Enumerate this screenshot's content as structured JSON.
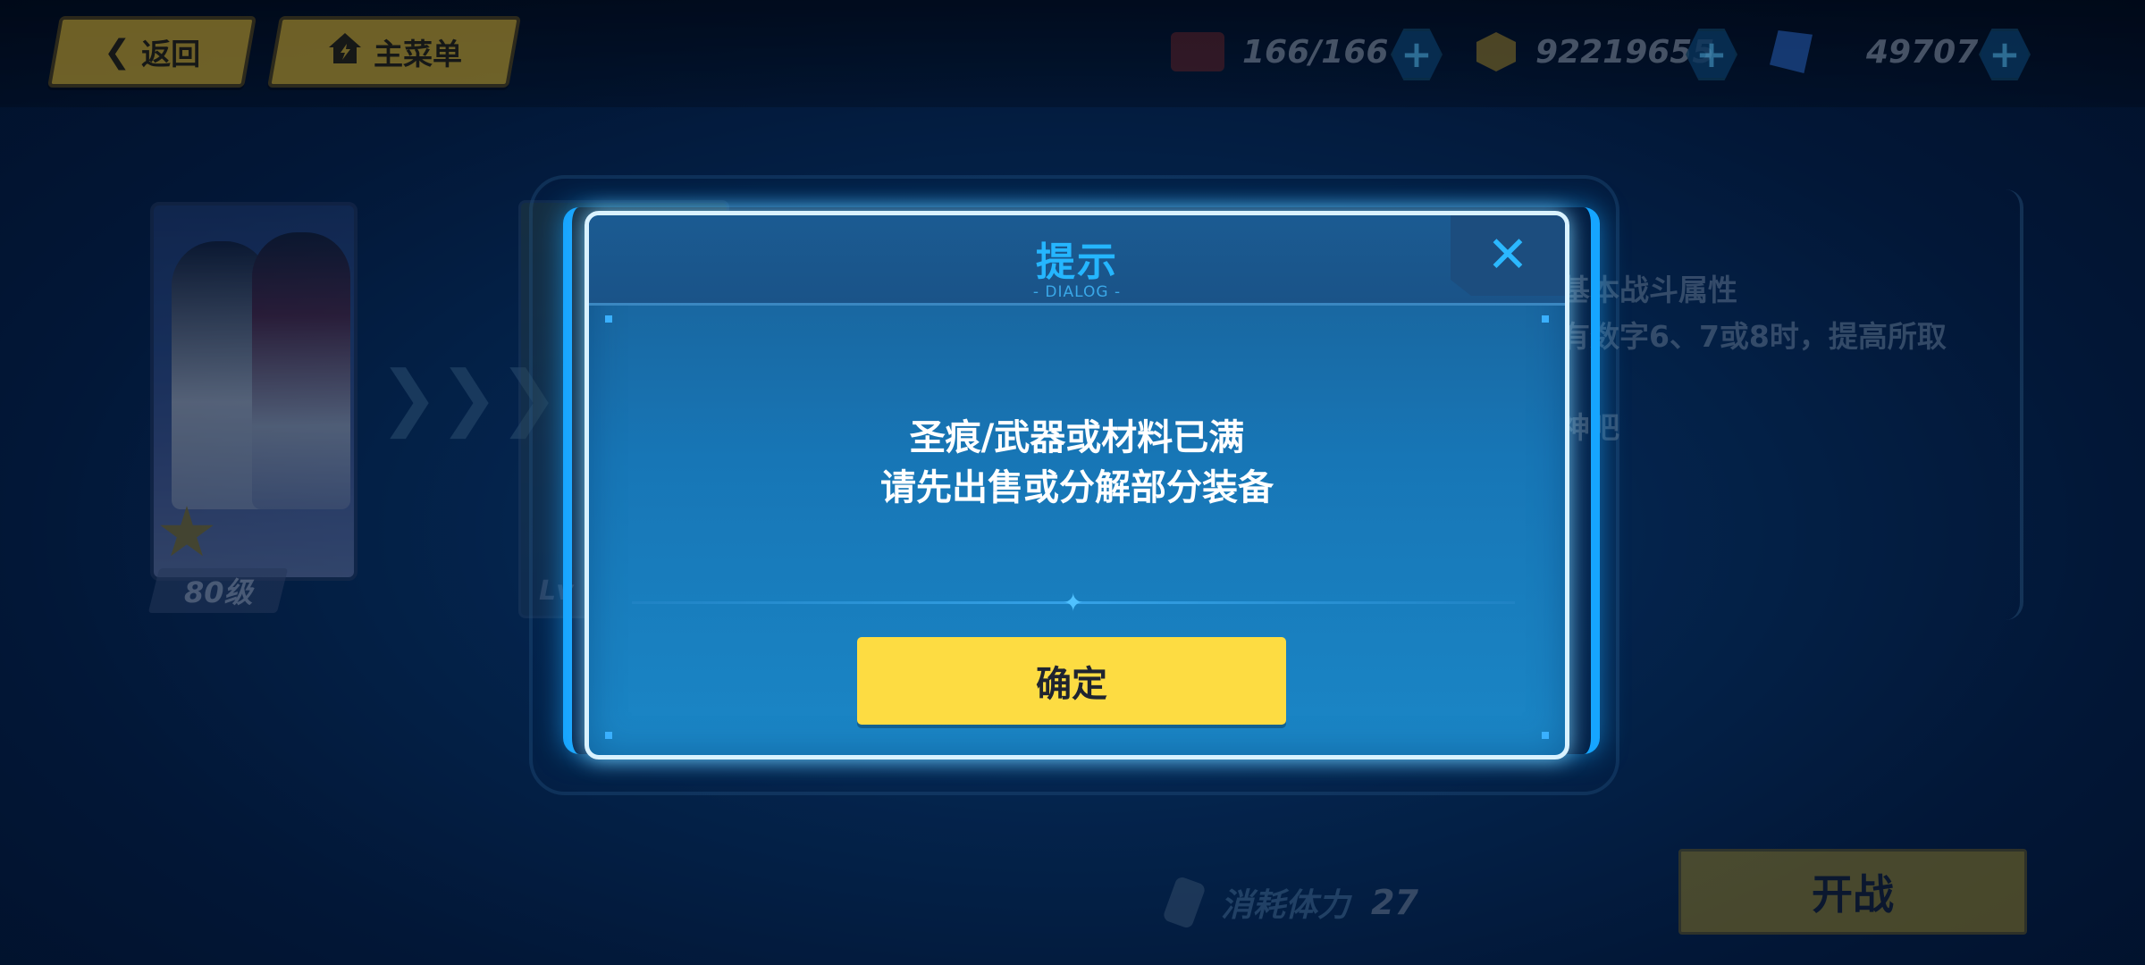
{
  "topbar": {
    "back_label": "返回",
    "menu_label": "主菜单",
    "stamina_value": "166/166",
    "coin_value": "92219655",
    "crystal_value": "49707"
  },
  "background": {
    "character_level": "80级",
    "card2_level_prefix": "Lv",
    "info_line1": "基本战斗属性",
    "info_line2": "有数字6、7或8时，提高所取",
    "info_line3": "神吧",
    "stamina_cost_label": "消耗体力",
    "stamina_cost_value": "27",
    "start_label": "开战"
  },
  "dialog": {
    "title": "提示",
    "subtitle": "- DIALOG -",
    "close_icon": "close-icon",
    "message_line1": "圣痕/武器或材料已满",
    "message_line2": "请先出售或分解部分装备",
    "confirm_label": "确定"
  },
  "colors": {
    "accent": "#25b6ff",
    "confirm": "#fddc42",
    "dialog_border": "#d9f2ff"
  }
}
